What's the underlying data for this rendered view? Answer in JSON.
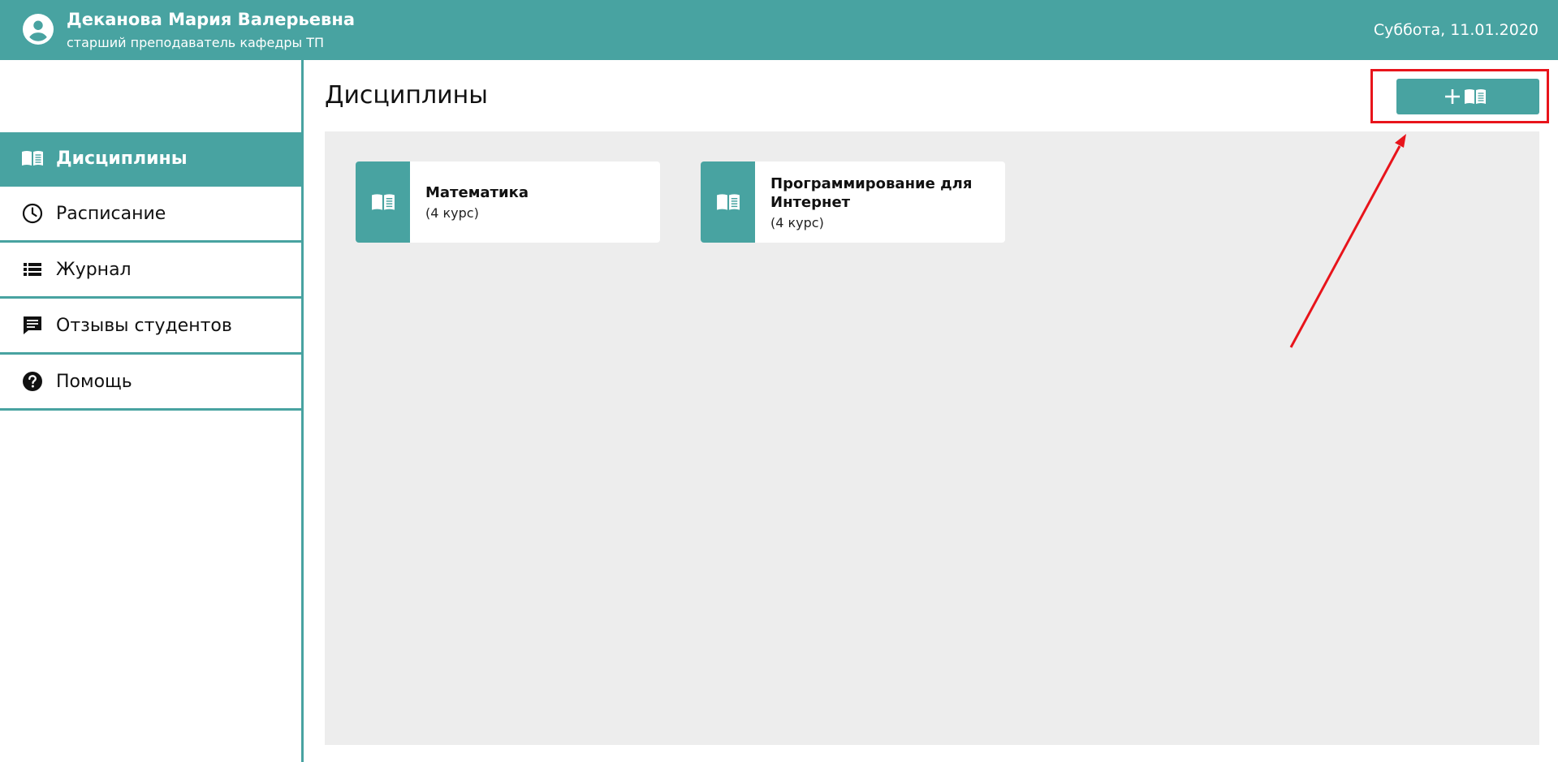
{
  "header": {
    "user_name": "Деканова Мария Валерьевна",
    "user_role": "старший преподаватель кафедры ТП",
    "date": "Суббота, 11.01.2020",
    "avatar_icon": "account-circle-icon"
  },
  "sidebar": {
    "items": [
      {
        "label": "Дисциплины",
        "icon": "book-open-icon",
        "active": true
      },
      {
        "label": "Расписание",
        "icon": "clock-icon",
        "active": false
      },
      {
        "label": "Журнал",
        "icon": "list-icon",
        "active": false
      },
      {
        "label": "Отзывы студентов",
        "icon": "comment-icon",
        "active": false
      },
      {
        "label": "Помощь",
        "icon": "help-circle-icon",
        "active": false
      }
    ]
  },
  "main": {
    "title": "Дисциплины",
    "add_button": {
      "plus": "+",
      "icon": "book-open-icon"
    },
    "disciplines": [
      {
        "title": "Математика",
        "course": "(4 курс)",
        "icon": "book-open-icon"
      },
      {
        "title": "Программирование для Интернет",
        "course": "(4 курс)",
        "icon": "book-open-icon"
      }
    ]
  },
  "colors": {
    "accent": "#48a3a1",
    "panel_bg": "#ededed",
    "highlight": "#e8141b"
  }
}
